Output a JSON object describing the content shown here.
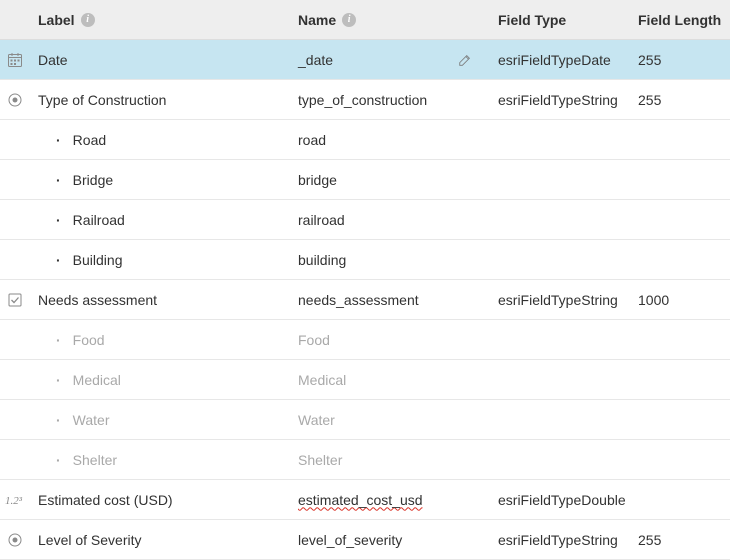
{
  "columns": {
    "label": "Label",
    "name": "Name",
    "field_type": "Field Type",
    "field_length": "Field Length"
  },
  "rows": [
    {
      "icon": "calendar-icon",
      "label": "Date",
      "name": "_date",
      "editable": true,
      "field_type": "esriFieldTypeDate",
      "field_length": "255",
      "selected": true
    },
    {
      "icon": "radio-icon",
      "label": "Type of Construction",
      "name": "type_of_construction",
      "field_type": "esriFieldTypeString",
      "field_length": "255",
      "children": [
        {
          "label": "Road",
          "name": "road"
        },
        {
          "label": "Bridge",
          "name": "bridge"
        },
        {
          "label": "Railroad",
          "name": "railroad"
        },
        {
          "label": "Building",
          "name": "building"
        }
      ]
    },
    {
      "icon": "checkbox-icon",
      "label": "Needs assessment",
      "name": "needs_assessment",
      "field_type": "esriFieldTypeString",
      "field_length": "1000",
      "children_muted": true,
      "children": [
        {
          "label": "Food",
          "name": "Food"
        },
        {
          "label": "Medical",
          "name": "Medical"
        },
        {
          "label": "Water",
          "name": "Water"
        },
        {
          "label": "Shelter",
          "name": "Shelter"
        }
      ]
    },
    {
      "icon": "number-icon",
      "label": "Estimated cost (USD)",
      "name": "estimated_cost_usd",
      "name_typo": true,
      "field_type": "esriFieldTypeDouble",
      "field_length": ""
    },
    {
      "icon": "radio-icon",
      "label": "Level of Severity",
      "name": "level_of_severity",
      "field_type": "esriFieldTypeString",
      "field_length": "255"
    }
  ]
}
